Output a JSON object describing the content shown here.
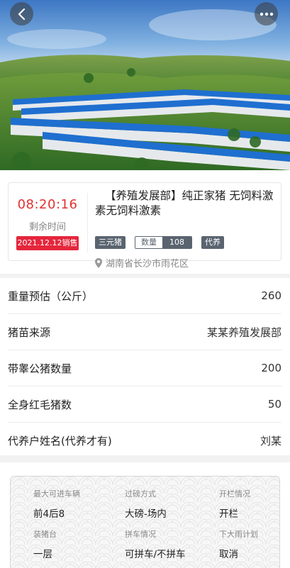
{
  "hero": {
    "back_icon": "chevron-left-icon",
    "more_icon": "more-dots-icon"
  },
  "product": {
    "countdown": "08:20:16",
    "countdown_label": "剩余时间",
    "sale_date": "2021.12.12销售",
    "title": "【养殖发展部】纯正家猪 无饲料激素无饲料激素",
    "tags": {
      "breed": "三元猪",
      "quantity_label": "数量",
      "quantity_value": "108",
      "type": "代养"
    },
    "location": "湖南省长沙市雨花区"
  },
  "info": {
    "rows": [
      {
        "label": "重量预估（公斤）",
        "value": "260"
      },
      {
        "label": "猪苗来源",
        "value": "某某养殖发展部"
      },
      {
        "label": "带睾公猪数量",
        "value": "200"
      },
      {
        "label": "全身红毛猪数",
        "value": "50"
      },
      {
        "label": "代养户姓名(代养才有)",
        "value": "刘某"
      }
    ]
  },
  "details": {
    "cells": [
      {
        "label": "最大可进车辆",
        "value": "前4后8"
      },
      {
        "label": "过磅方式",
        "value": "大磅-场内"
      },
      {
        "label": "开栏情况",
        "value": "开栏"
      },
      {
        "label": "装猪台",
        "value": "一层"
      },
      {
        "label": "拼车情况",
        "value": "可拼车/不拼车"
      },
      {
        "label": "下大雨计划",
        "value": "取消"
      }
    ]
  },
  "colors": {
    "accent_red": "#e23030",
    "badge_red": "#e4263c",
    "tag_gray": "#5a6470"
  }
}
